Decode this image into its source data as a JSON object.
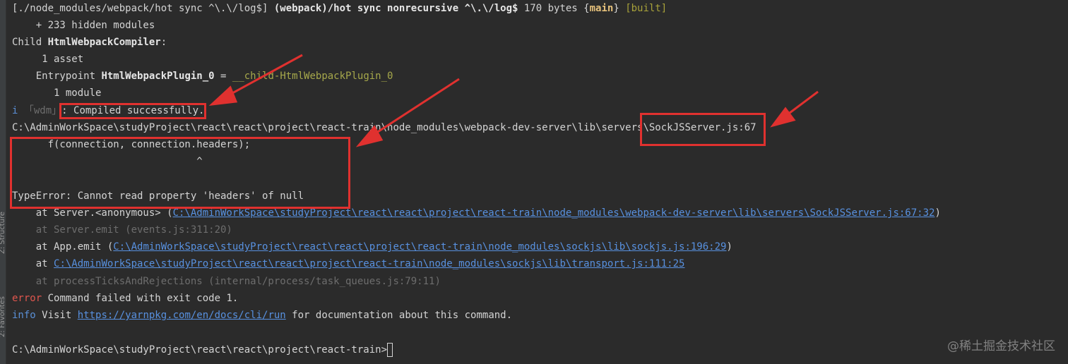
{
  "side_panel": {
    "structure_label": "Z: Structure",
    "favorites_label": "2: Favorites"
  },
  "lines": {
    "l1": {
      "a": "[./node_modules/webpack/hot sync ^\\.\\/log$] ",
      "b": "(webpack)/hot sync nonrecursive ^\\.\\/log$",
      "c": " 170 bytes {",
      "d": "main",
      "e": "} ",
      "f": "[built]"
    },
    "l2": "    + 233 hidden modules",
    "l3": {
      "a": "Child ",
      "b": "HtmlWebpackCompiler",
      "c": ":"
    },
    "l4": "     1 asset",
    "l5": {
      "a": "    Entrypoint ",
      "b": "HtmlWebpackPlugin_0",
      "c": " = ",
      "d": "__child-HtmlWebpackPlugin_0"
    },
    "l6": "       1 module",
    "l7": {
      "i": "i",
      "wdm": " 「wdm」",
      "c": ": Compiled successfully."
    },
    "l8": "C:\\AdminWorkSpace\\studyProject\\react\\react\\project\\react-train\\node_modules\\webpack-dev-server\\lib\\servers\\SockJSServer.js:67",
    "l9": "      f(connection, connection.headers);",
    "l10": "                               ^",
    "l12": "TypeError: Cannot read property 'headers' of null",
    "l13": {
      "a": "    at Server.<anonymous> (",
      "link": "C:\\AdminWorkSpace\\studyProject\\react\\react\\project\\react-train\\node_modules\\webpack-dev-server\\lib\\servers\\SockJSServer.js:67:32",
      "b": ")"
    },
    "l14": "    at Server.emit (events.js:311:20)",
    "l15": {
      "a": "    at App.emit (",
      "link": "C:\\AdminWorkSpace\\studyProject\\react\\react\\project\\react-train\\node_modules\\sockjs\\lib\\sockjs.js:196:29",
      "b": ")"
    },
    "l16": {
      "a": "    at ",
      "link": "C:\\AdminWorkSpace\\studyProject\\react\\react\\project\\react-train\\node_modules\\sockjs\\lib\\transport.js:111:25"
    },
    "l17": "    at processTicksAndRejections (internal/process/task_queues.js:79:11)",
    "l18": {
      "a": "error",
      "b": " Command failed with exit code 1."
    },
    "l19": {
      "a": "info",
      "b": " Visit ",
      "link": "https://yarnpkg.com/en/docs/cli/run",
      "c": " for documentation about this command."
    },
    "l21": "C:\\AdminWorkSpace\\studyProject\\react\\react\\project\\react-train>"
  },
  "watermark": "@稀土掘金技术社区",
  "colors": {
    "background": "#2b2b2b",
    "text": "#d4d4d4",
    "annotation_red": "#e0312f",
    "link": "#5891e0",
    "error": "#e0564e"
  }
}
